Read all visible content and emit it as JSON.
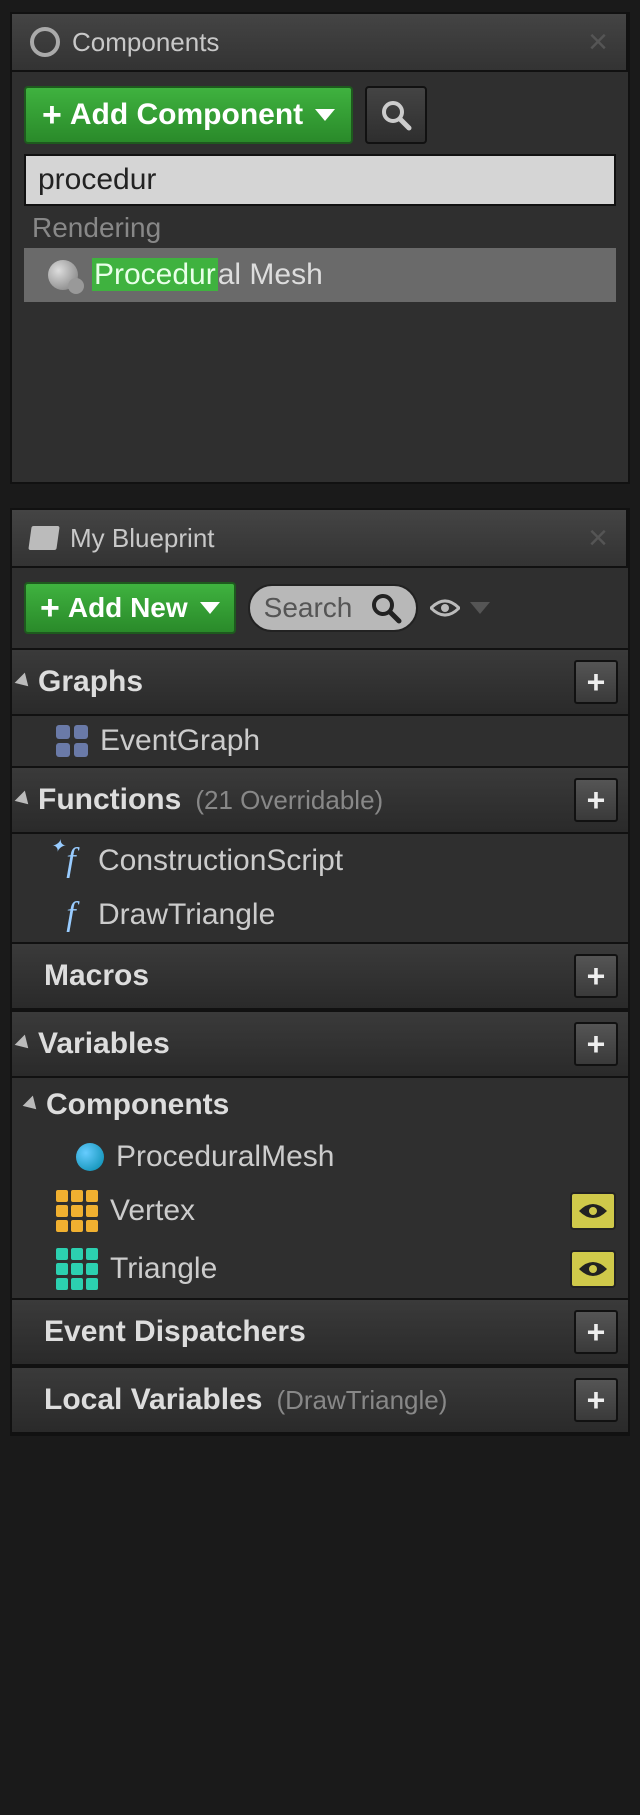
{
  "components_panel": {
    "title": "Components",
    "add_button": "Add Component",
    "search_value": "procedur",
    "category": "Rendering",
    "result_highlight": "Procedur",
    "result_rest": "al Mesh"
  },
  "blueprint_panel": {
    "title": "My Blueprint",
    "add_button": "Add New",
    "search_placeholder": "Search",
    "sections": {
      "graphs": {
        "label": "Graphs"
      },
      "functions": {
        "label": "Functions",
        "sub": "(21 Overridable)"
      },
      "macros": {
        "label": "Macros"
      },
      "variables": {
        "label": "Variables"
      },
      "components": {
        "label": "Components"
      },
      "dispatchers": {
        "label": "Event Dispatchers"
      },
      "localvars": {
        "label": "Local Variables",
        "sub": "(DrawTriangle)"
      }
    },
    "items": {
      "event_graph": "EventGraph",
      "construction": "ConstructionScript",
      "draw_triangle": "DrawTriangle",
      "proc_mesh": "ProceduralMesh",
      "vertex": "Vertex",
      "triangle": "Triangle"
    }
  }
}
